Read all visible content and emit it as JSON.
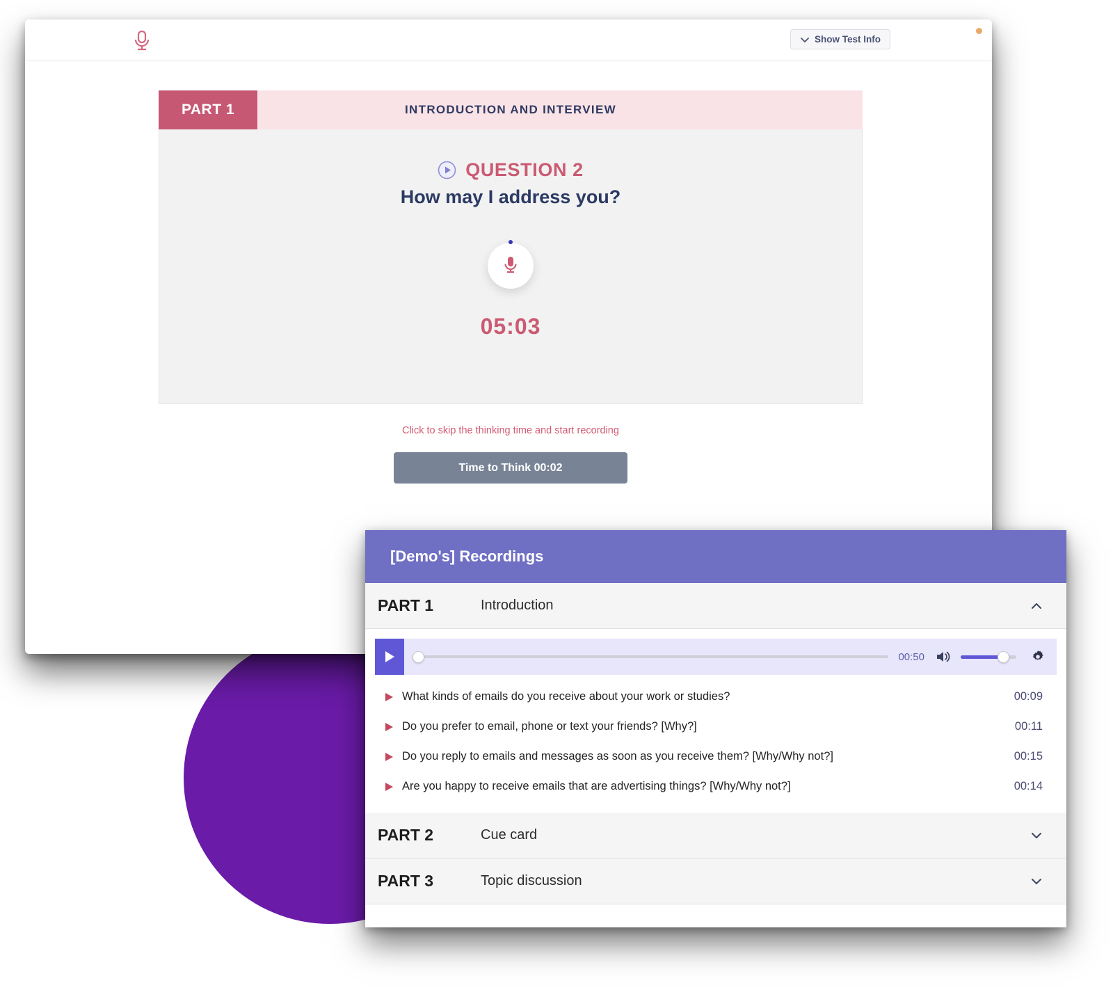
{
  "app": {
    "brand_icon": "microphone-icon",
    "status_dot_color": "#e8a96a"
  },
  "topbar": {
    "show_test_info_label": "Show Test Info",
    "show_test_info_icon": "chevron-down-icon"
  },
  "test": {
    "part_badge": "PART 1",
    "part_title": "INTRODUCTION AND INTERVIEW",
    "question_label": "QUESTION 2",
    "question_play_icon": "play-circle-icon",
    "question_text": "How may I address you?",
    "mic_icon": "microphone-icon",
    "recording_timer": "05:03",
    "skip_hint": "Click to skip the thinking time and start recording",
    "think_button_label": "Time to Think 00:02"
  },
  "recordings": {
    "title": "[Demo's] Recordings",
    "parts": [
      {
        "num": "PART 1",
        "name": "Introduction",
        "chevron": "chevron-up-icon",
        "expanded": true,
        "player": {
          "play_icon": "play-icon",
          "duration": "00:50",
          "volume_icon": "volume-icon",
          "settings_icon": "gear-icon"
        },
        "questions": [
          {
            "icon": "play-triangle-icon",
            "text": "What kinds of emails do you receive about your work or studies?",
            "time": "00:09"
          },
          {
            "icon": "play-triangle-icon",
            "text": "Do you prefer to email, phone or text your friends? [Why?]",
            "time": "00:11"
          },
          {
            "icon": "play-triangle-icon",
            "text": "Do you reply to emails and messages as soon as you receive them? [Why/Why not?]",
            "time": "00:15"
          },
          {
            "icon": "play-triangle-icon",
            "text": "Are you happy to receive emails that are advertising things? [Why/Why not?]",
            "time": "00:14"
          }
        ]
      },
      {
        "num": "PART 2",
        "name": "Cue card",
        "chevron": "chevron-down-icon",
        "expanded": false
      },
      {
        "num": "PART 3",
        "name": "Topic discussion",
        "chevron": "chevron-down-icon",
        "expanded": false
      }
    ]
  },
  "colors": {
    "accent_pink": "#c75874",
    "accent_purple": "#6f6fc4",
    "player_purple": "#5f57d6",
    "deco_purple": "#6A1BA8",
    "navy": "#2b3a63",
    "think_gray": "#788496"
  }
}
